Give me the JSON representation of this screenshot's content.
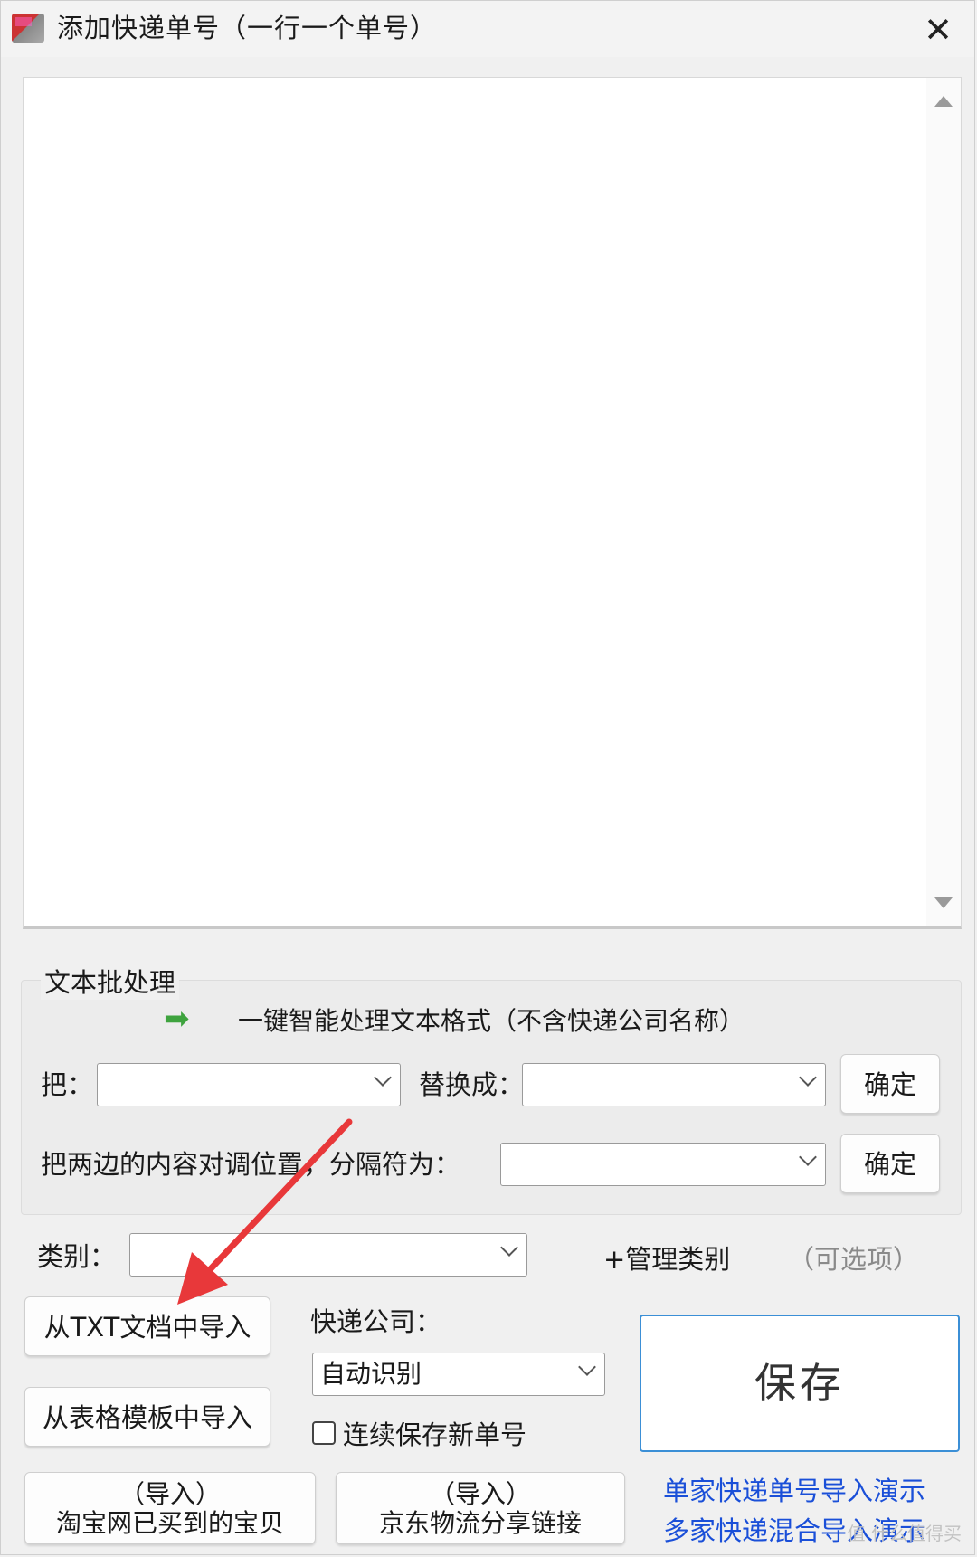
{
  "window": {
    "title": "添加快递单号（一行一个单号）",
    "close_glyph": "✕"
  },
  "textarea": {
    "value": ""
  },
  "batch": {
    "legend": "文本批处理",
    "smart_arrow": "➡",
    "smart_format_label": "一键智能处理文本格式（不含快递公司名称）",
    "replace_from_label": "把：",
    "replace_from_value": "",
    "replace_to_label": "替换成：",
    "replace_to_value": "",
    "confirm_label": "确定",
    "swap_label": "把两边的内容对调位置，分隔符为：",
    "swap_separator_value": "",
    "confirm2_label": "确定"
  },
  "category": {
    "label": "类别：",
    "value": "",
    "manage_label": "+管理类别",
    "optional_label": "（可选项）"
  },
  "import": {
    "txt_label": "从TXT文档中导入",
    "template_label": "从表格模板中导入",
    "taobao_line1": "（导入）",
    "taobao_line2": "淘宝网已买到的宝贝",
    "jd_line1": "（导入）",
    "jd_line2": "京东物流分享链接"
  },
  "courier": {
    "label": "快递公司：",
    "value": "自动识别",
    "continuous_save_label": "连续保存新单号",
    "continuous_save_checked": false
  },
  "save": {
    "label": "保存"
  },
  "demo": {
    "single_label": "单家快递单号导入演示",
    "multi_label": "多家快递混合导入演示"
  },
  "watermark": "值 什么值得买",
  "colors": {
    "accent_blue": "#1a4fd8",
    "save_border": "#3b8fd6",
    "annotation_red": "#e8383a",
    "arrow_green": "#3ea33e"
  }
}
